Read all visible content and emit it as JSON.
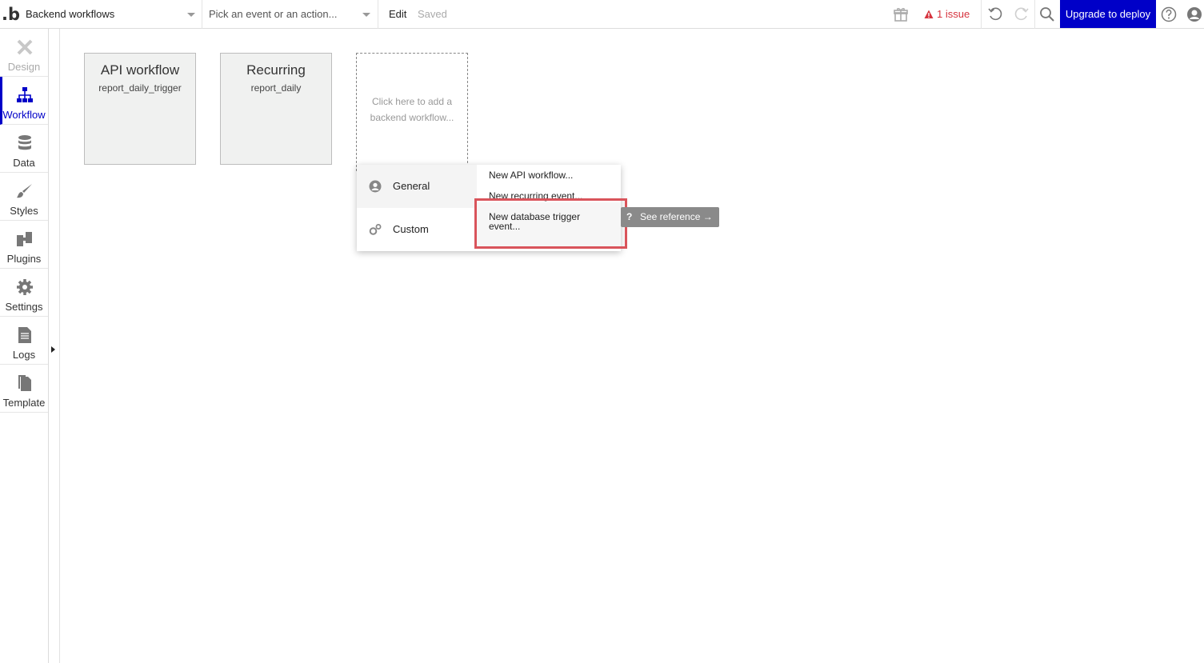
{
  "header": {
    "page_select": "Backend workflows",
    "event_select": "Pick an event or an action...",
    "edit": "Edit",
    "saved": "Saved",
    "issue": "1 issue",
    "upgrade": "Upgrade to deploy"
  },
  "sidebar": {
    "items": [
      {
        "label": "Design",
        "icon": "design-icon"
      },
      {
        "label": "Workflow",
        "icon": "workflow-icon"
      },
      {
        "label": "Data",
        "icon": "database-icon"
      },
      {
        "label": "Styles",
        "icon": "brush-icon"
      },
      {
        "label": "Plugins",
        "icon": "plugins-icon"
      },
      {
        "label": "Settings",
        "icon": "gear-icon"
      },
      {
        "label": "Logs",
        "icon": "document-icon"
      },
      {
        "label": "Template",
        "icon": "template-icon"
      }
    ]
  },
  "workflows": [
    {
      "title": "API workflow",
      "name": "report_daily_trigger"
    },
    {
      "title": "Recurring",
      "name": "report_daily"
    }
  ],
  "add_card": {
    "text": "Click here to add a backend workflow..."
  },
  "menu": {
    "categories": [
      {
        "label": "General",
        "icon": "person-circle-icon"
      },
      {
        "label": "Custom",
        "icon": "gears-icon"
      }
    ],
    "options": [
      "New API workflow...",
      "New recurring event...",
      "New database trigger event..."
    ]
  },
  "reference": {
    "label": "See reference →"
  },
  "colors": {
    "accent": "#0000c8",
    "issue": "#d6333e",
    "highlight": "#d9545b"
  }
}
